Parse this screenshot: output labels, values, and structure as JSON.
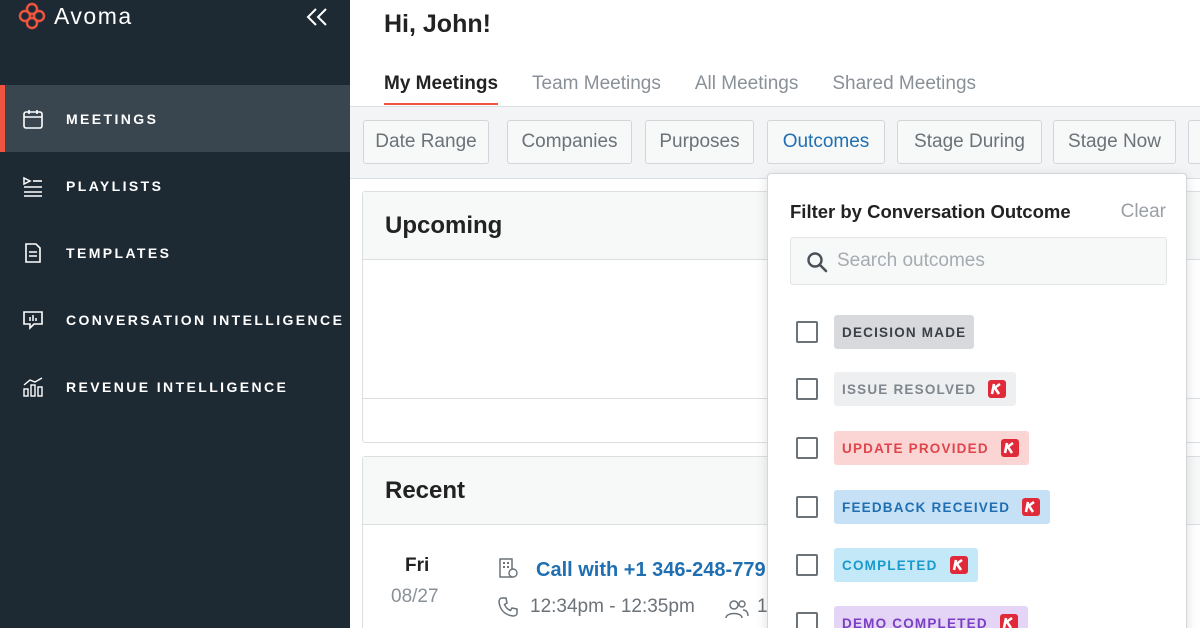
{
  "app": {
    "logo_text": "Avoma"
  },
  "sidebar": {
    "items": [
      {
        "label": "MEETINGS",
        "icon": "calendar-icon",
        "active": true
      },
      {
        "label": "PLAYLISTS",
        "icon": "playlist-icon",
        "active": false
      },
      {
        "label": "TEMPLATES",
        "icon": "document-icon",
        "active": false
      },
      {
        "label": "CONVERSATION INTELLIGENCE",
        "icon": "chat-chart-icon",
        "active": false
      },
      {
        "label": "REVENUE INTELLIGENCE",
        "icon": "bar-chart-icon",
        "active": false
      }
    ]
  },
  "header": {
    "greeting": "Hi, John!"
  },
  "tabs": [
    {
      "label": "My Meetings",
      "active": true
    },
    {
      "label": "Team Meetings",
      "active": false
    },
    {
      "label": "All Meetings",
      "active": false
    },
    {
      "label": "Shared Meetings",
      "active": false
    }
  ],
  "filters": [
    {
      "label": "Date Range"
    },
    {
      "label": "Companies"
    },
    {
      "label": "Purposes"
    },
    {
      "label": "Outcomes",
      "active": true
    },
    {
      "label": "Stage During"
    },
    {
      "label": "Stage Now"
    }
  ],
  "upcoming": {
    "title": "Upcoming"
  },
  "recent": {
    "title": "Recent",
    "meeting": {
      "day": "Fri",
      "date": "08/27",
      "title": "Call with +1 346-248-779",
      "time": "12:34pm - 12:35pm",
      "attendees": "1"
    }
  },
  "dropdown": {
    "title": "Filter by Conversation Outcome",
    "clear_label": "Clear",
    "search_placeholder": "Search outcomes",
    "options": [
      {
        "label": "DECISION MADE",
        "bg": "#d7d9dc",
        "fg": "#3b4146",
        "badge": false
      },
      {
        "label": "ISSUE RESOLVED",
        "bg": "#eeeff0",
        "fg": "#7f868c",
        "badge": true
      },
      {
        "label": "UPDATE PROVIDED",
        "bg": "#fbd4d4",
        "fg": "#e0454b",
        "badge": true
      },
      {
        "label": "FEEDBACK RECEIVED",
        "bg": "#c6e0f5",
        "fg": "#1f6fb2",
        "badge": true
      },
      {
        "label": "COMPLETED",
        "bg": "#c3e8f7",
        "fg": "#1a9acb",
        "badge": true
      },
      {
        "label": "DEMO COMPLETED",
        "bg": "#e4d4f5",
        "fg": "#7a3fc2",
        "badge": true
      }
    ]
  },
  "colors": {
    "accent": "#f0543f",
    "link": "#1f6fb2",
    "sidebar": "#1e2a33",
    "badge": "#e02a3a"
  }
}
